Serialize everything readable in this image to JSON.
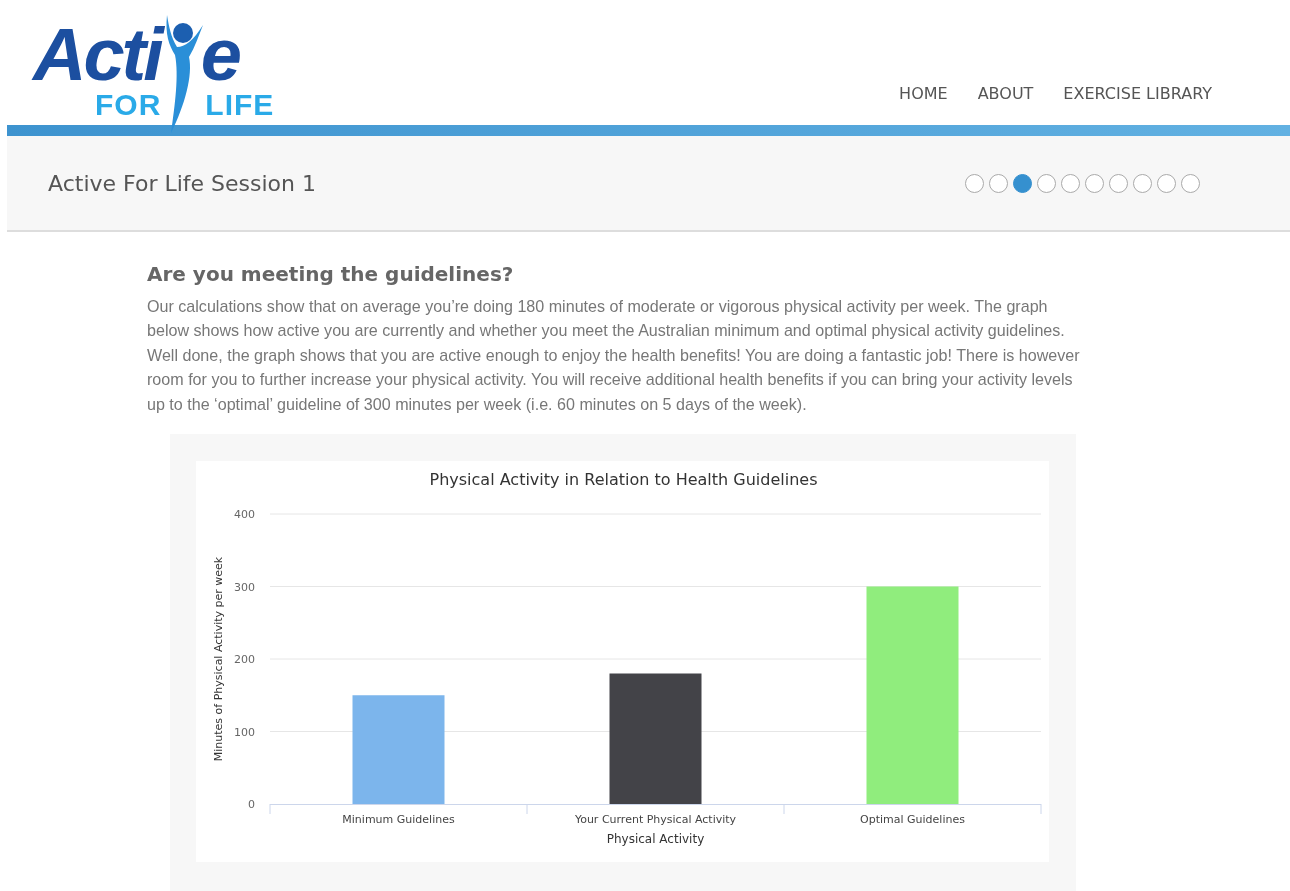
{
  "logo": {
    "word_start": "Acti",
    "word_end": "e",
    "tagline_start": "FOR",
    "tagline_end": "LIFE"
  },
  "nav": [
    {
      "label": "HOME"
    },
    {
      "label": "ABOUT"
    },
    {
      "label": "EXERCISE LIBRARY"
    }
  ],
  "session": {
    "title": "Active For Life Session 1",
    "steps": [
      {
        "selected": false
      },
      {
        "selected": false
      },
      {
        "selected": true
      },
      {
        "selected": false
      },
      {
        "selected": false
      },
      {
        "selected": false
      },
      {
        "selected": false
      },
      {
        "selected": false
      },
      {
        "selected": false
      },
      {
        "selected": false
      }
    ]
  },
  "content": {
    "heading": "Are you meeting the guidelines?",
    "paragraph": "Our calculations show that on average you’re doing 180 minutes of moderate or vigorous physical activity per week. The graph below shows how active you are currently and whether you meet the Australian minimum and optimal physical activity guidelines. Well done, the graph shows that you are active enough to enjoy the health benefits! You are doing a fantastic job! There is however room for you to further increase your physical activity. You will receive additional health benefits if you can bring your activity levels up to the ‘optimal’ guideline of 300 minutes per week (i.e. 60 minutes on 5 days of the week).",
    "chart_data": {
      "type": "bar",
      "title": "Physical Activity in Relation to Health Guidelines",
      "xlabel": "Physical Activity",
      "ylabel": "Minutes of Physical Activity per week",
      "categories": [
        "Minimum Guidelines",
        "Your Current Physical Activity",
        "Optimal Guidelines"
      ],
      "series": [
        {
          "color": "#7cb5ec",
          "values": [
            150,
            null,
            null
          ]
        },
        {
          "color": "#434348",
          "values": [
            null,
            180,
            null
          ]
        },
        {
          "color": "#90ed7d",
          "values": [
            null,
            null,
            300
          ]
        }
      ],
      "grid": true,
      "ylim": [
        0,
        400
      ],
      "yticks": [
        0,
        100,
        200,
        300,
        400
      ]
    }
  }
}
